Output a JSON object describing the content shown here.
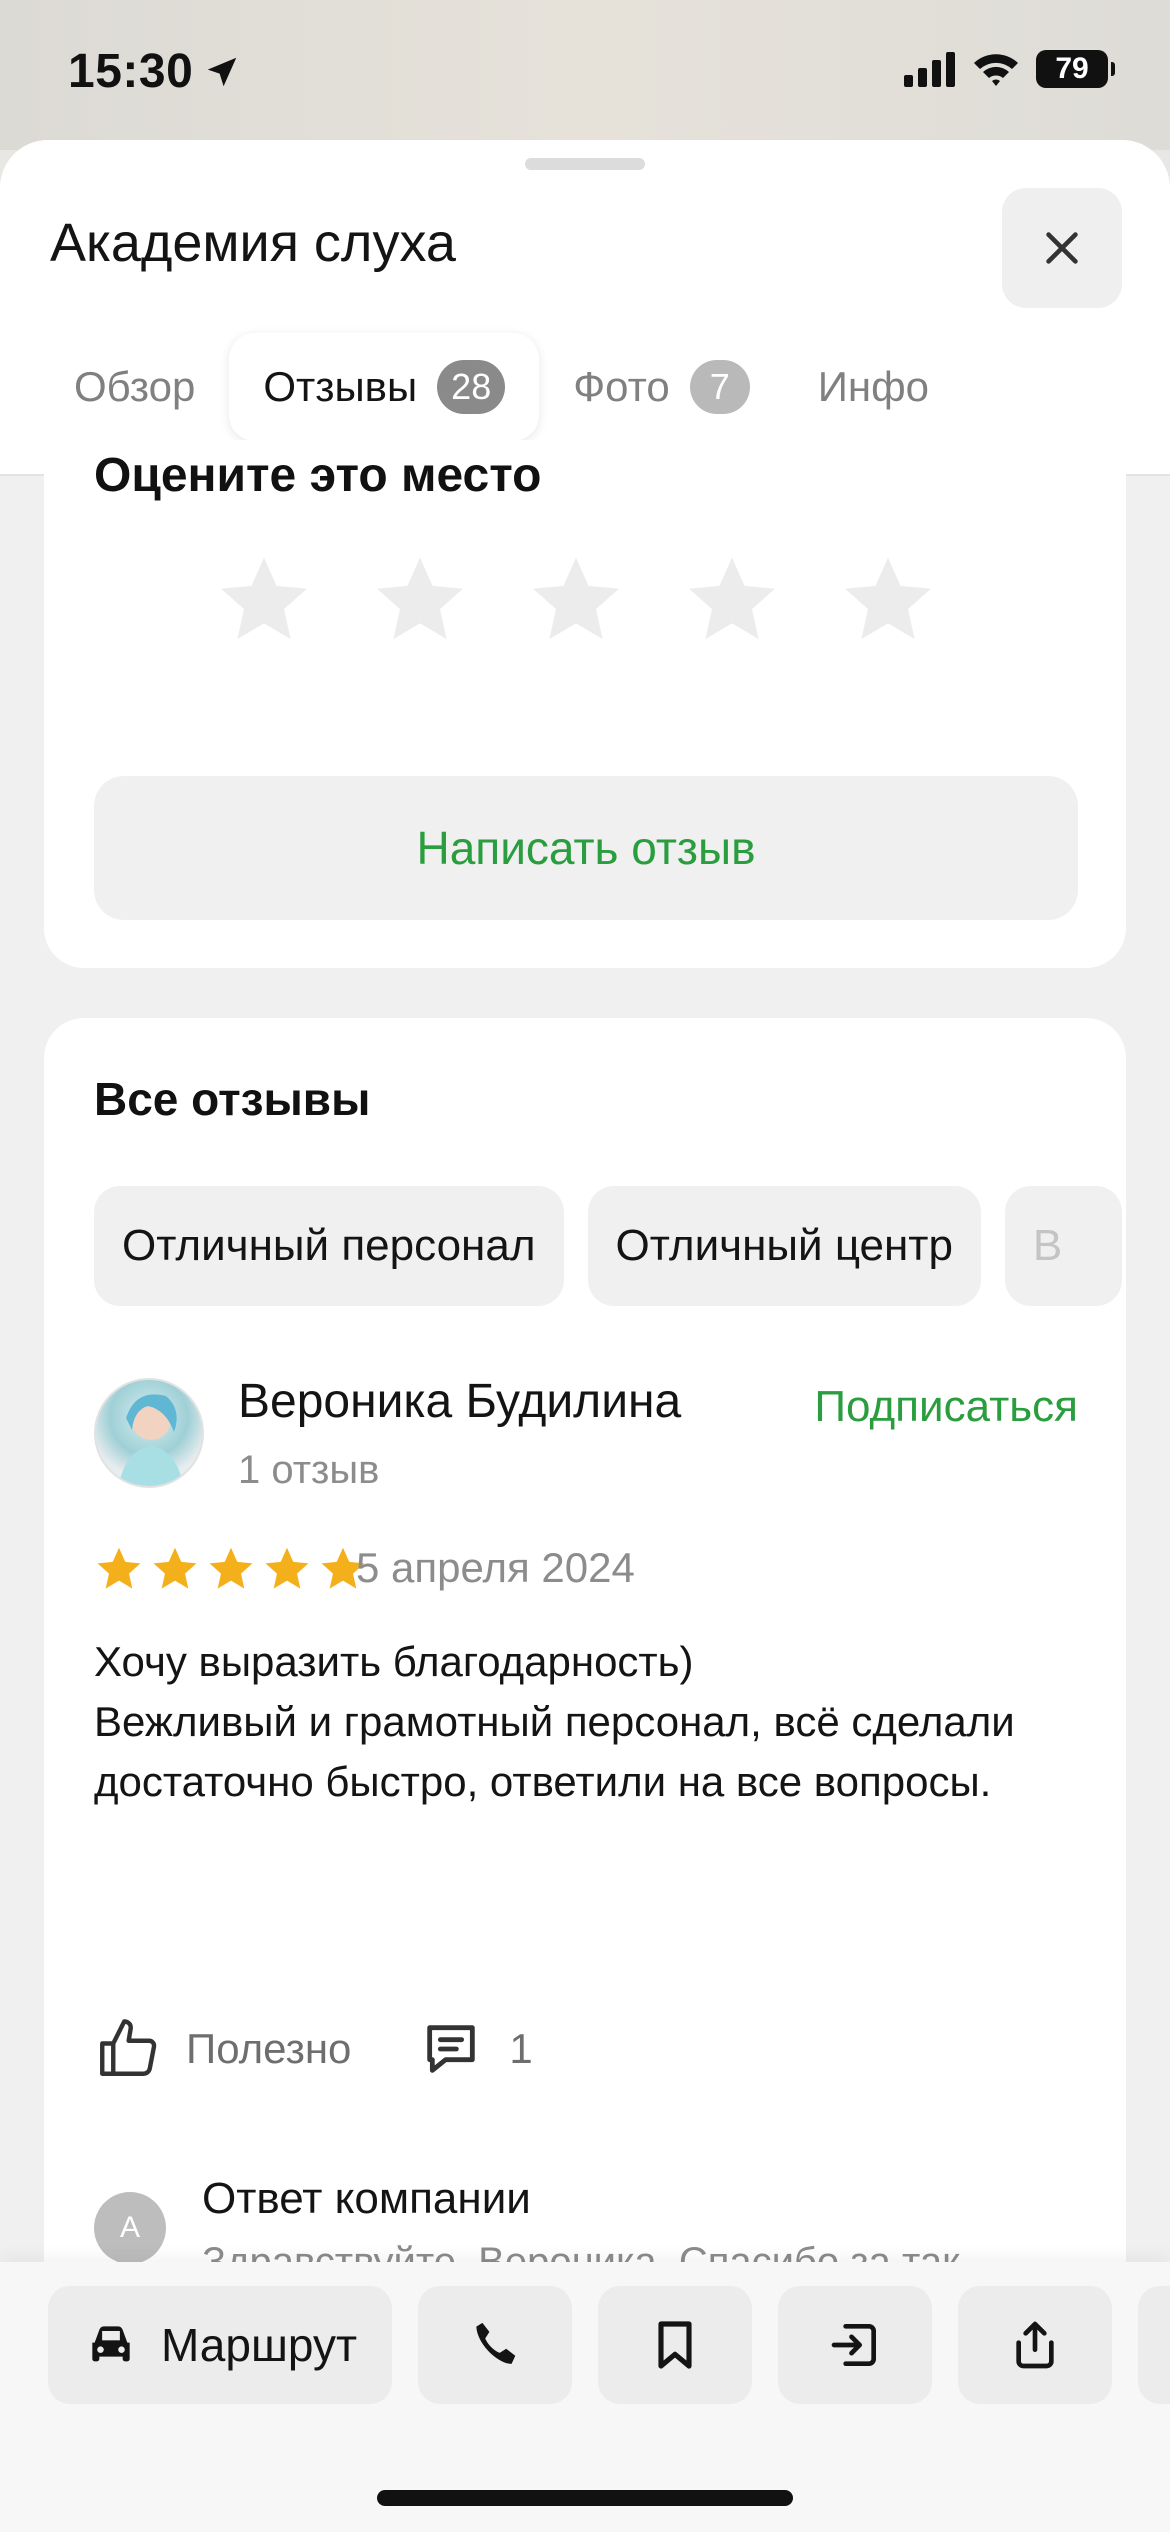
{
  "status_bar": {
    "time": "15:30",
    "battery": "79"
  },
  "header": {
    "title": "Академия слуха",
    "tabs": [
      {
        "label": "Обзор",
        "badge": ""
      },
      {
        "label": "Отзывы",
        "badge": "28"
      },
      {
        "label": "Фото",
        "badge": "7"
      },
      {
        "label": "Инфо",
        "badge": ""
      }
    ],
    "active_tab": "Отзывы"
  },
  "rate_card": {
    "title": "Оцените это место",
    "stars_count": 5,
    "write_button": "Написать отзыв"
  },
  "reviews": {
    "title": "Все отзывы",
    "chips": [
      "Отличный персонал",
      "Отличный центр",
      "В"
    ],
    "review": {
      "author": "Вероника Будилина",
      "author_reviews": "1 отзыв",
      "subscribe_label": "Подписаться",
      "rating": 5,
      "date": "5 апреля 2024",
      "text": "Хочу выразить благодарность)\nВежливый и грамотный персонал, всё сделали достаточно быстро, ответили на все вопросы.",
      "helpful_label": "Полезно",
      "comments_count": "1",
      "reply": {
        "avatar_letter": "А",
        "title": "Ответ компании",
        "text": "Здравствуйте, Вероника. Спасибо за так..."
      }
    }
  },
  "bottom_bar": {
    "route_label": "Маршрут",
    "buttons": [
      "phone-icon",
      "bookmark-icon",
      "enter-icon",
      "share-icon"
    ]
  },
  "colors": {
    "accent_green": "#2a9d3f",
    "star_gold": "#f3b01b",
    "star_empty": "#ececec"
  }
}
